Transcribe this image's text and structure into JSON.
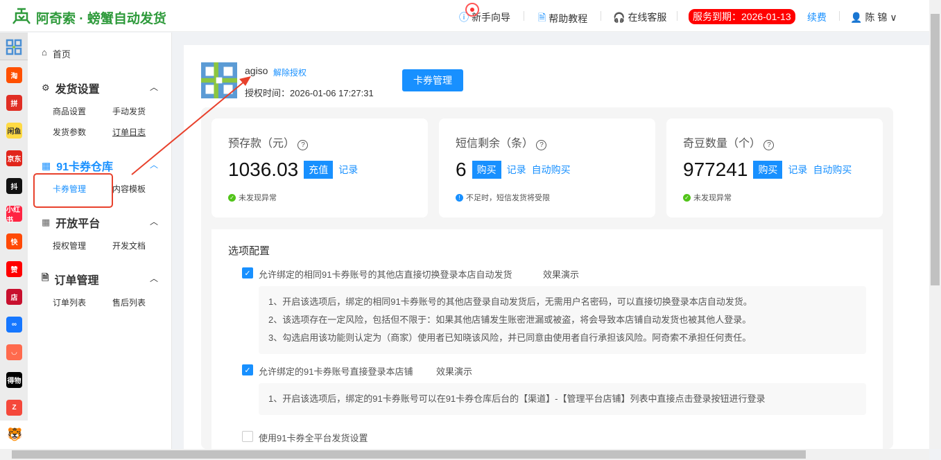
{
  "header": {
    "brand": "阿奇索 · 螃蟹自动发货",
    "guide": "新手向导",
    "help": "帮助教程",
    "service": "在线客服",
    "expire": "服务到期：2026-01-13",
    "renew": "续费",
    "user": "陈  锦"
  },
  "rail": [
    {
      "label": "淘",
      "color": "#ff5000"
    },
    {
      "label": "拼",
      "color": "#e02e24"
    },
    {
      "label": "闲鱼",
      "color": "#ffda44"
    },
    {
      "label": "京东",
      "color": "#e1251b"
    },
    {
      "label": "抖",
      "color": "#111111"
    },
    {
      "label": "小红书",
      "color": "#ff2442"
    },
    {
      "label": "快",
      "color": "#ff4906"
    },
    {
      "label": "赞",
      "color": "#f00"
    },
    {
      "label": "店",
      "color": "#c8102e"
    },
    {
      "label": "∞",
      "color": "#1677ff"
    },
    {
      "label": "◡",
      "color": "#ff6a4d"
    },
    {
      "label": "得物",
      "color": "#000000"
    },
    {
      "label": "Z",
      "color": "#f5483b"
    }
  ],
  "nav": {
    "home": "首页",
    "groups": [
      {
        "title": "发货设置",
        "items": [
          "商品设置",
          "手动发货",
          "发货参数",
          "订单日志"
        ]
      },
      {
        "title": "91卡券仓库",
        "items": [
          "卡券管理",
          "内容模板"
        ]
      },
      {
        "title": "开放平台",
        "items": [
          "授权管理",
          "开发文档"
        ]
      },
      {
        "title": "订单管理",
        "items": [
          "订单列表",
          "售后列表"
        ]
      }
    ]
  },
  "account": {
    "name": "agiso",
    "unbind": "解除授权",
    "auth_time": "授权时间：2026-01-06 17:27:31",
    "manage_btn": "卡券管理"
  },
  "cards": [
    {
      "title": "预存款（元）",
      "value": "1036.03",
      "btn": "充值",
      "links": [
        "记录"
      ],
      "note": "未发现异常",
      "status": "ok"
    },
    {
      "title": "短信剩余（条）",
      "value": "6",
      "btn": "购买",
      "links": [
        "记录",
        "自动购买"
      ],
      "note": "不足时，短信发货将受限",
      "status": "info"
    },
    {
      "title": "奇豆数量（个）",
      "value": "977241",
      "btn": "购买",
      "links": [
        "记录",
        "自动购买"
      ],
      "note": "未发现异常",
      "status": "ok"
    }
  ],
  "options": {
    "title": "选项配置",
    "demo": "效果演示",
    "opt1": {
      "label": "允许绑定的相同91卡券账号的其他店直接切换登录本店自动发货",
      "checked": true,
      "desc": [
        "1、开启该选项后，绑定的相同91卡券账号的其他店登录自动发货后，无需用户名密码，可以直接切换登录本店自动发货。",
        "2、该选项存在一定风险，包括但不限于：如果其他店铺发生账密泄漏或被盗，将会导致本店铺自动发货也被其他人登录。",
        "3、勾选启用该功能则认定为（商家）使用者已知晓该风险，并已同意由使用者自行承担该风险。阿奇索不承担任何责任。"
      ]
    },
    "opt2": {
      "label": "允许绑定的91卡券账号直接登录本店铺",
      "checked": true,
      "desc": [
        "1、开启该选项后，绑定的91卡券账号可以在91卡券仓库后台的【渠道】-【管理平台店铺】列表中直接点击登录按钮进行登录"
      ]
    },
    "opt3": {
      "label": "使用91卡券全平台发货设置",
      "checked": false
    }
  }
}
